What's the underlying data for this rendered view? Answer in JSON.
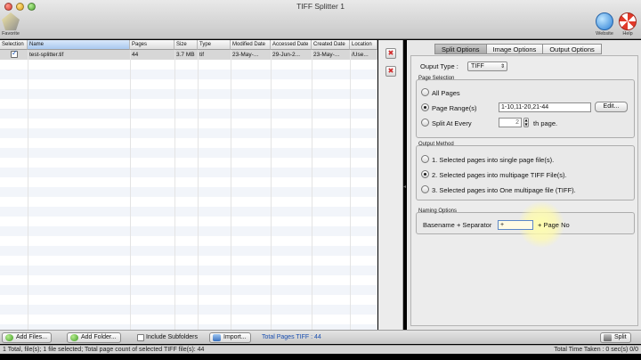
{
  "window": {
    "title": "TIFF Splitter 1"
  },
  "toolbar": {
    "favorite_label": "Favorite",
    "website_label": "Website",
    "help_label": "Help"
  },
  "table": {
    "columns": [
      "Selection",
      "Name",
      "Pages",
      "Size",
      "Type",
      "Modified Date",
      "Accessed Date",
      "Created Date",
      "Location"
    ],
    "rows": [
      {
        "selected": true,
        "name": "test-splitter.tif",
        "pages": "44",
        "size": "3.7 MB",
        "type": "tif",
        "modified": "23-May-...",
        "accessed": "29-Jun-2...",
        "created": "23-May-...",
        "location": "/Use..."
      }
    ]
  },
  "right_panel": {
    "tabs": [
      "Split Options",
      "Image Options",
      "Output Options"
    ],
    "active_tab": 0,
    "output_type_label": "Ouput Type :",
    "output_type_value": "TIFF",
    "page_selection": {
      "title": "Page Selection",
      "all_pages": "All Pages",
      "page_ranges": "Page Range(s)",
      "page_ranges_value": "1-10,11-20,21-44",
      "edit_button": "Edit...",
      "split_every": "Split At Every",
      "split_every_value": "2",
      "split_every_suffix": "th page.",
      "selected": "page_ranges"
    },
    "output_method": {
      "title": "Output Method",
      "options": [
        "1. Selected pages into single page file(s).",
        "2. Selected pages into multipage TIFF File(s).",
        "3. Selected pages into One multipage file (TIFF)."
      ],
      "selected_index": 1
    },
    "naming": {
      "title": "Naming Options",
      "prefix_label": "Basename + Separator",
      "separator_value": "+",
      "suffix_label": "+ Page No"
    }
  },
  "bottom_bar": {
    "add_files": "Add Files...",
    "add_folder": "Add Folder...",
    "include_subfolders": "Include Subfolders",
    "import": "Import...",
    "total_pages": "Total Pages TIFF : 44",
    "split": "Split"
  },
  "status": {
    "left": "1 Total, file(s); 1 file selected; Total page count of selected TIFF file(s): 44",
    "right": "Total Time Taken : 0 sec(s) 0/0"
  },
  "colors": {
    "accent_blue": "#1a4fb0",
    "selection_row": "#d7d7d7",
    "highlight": "#fffaa8"
  }
}
